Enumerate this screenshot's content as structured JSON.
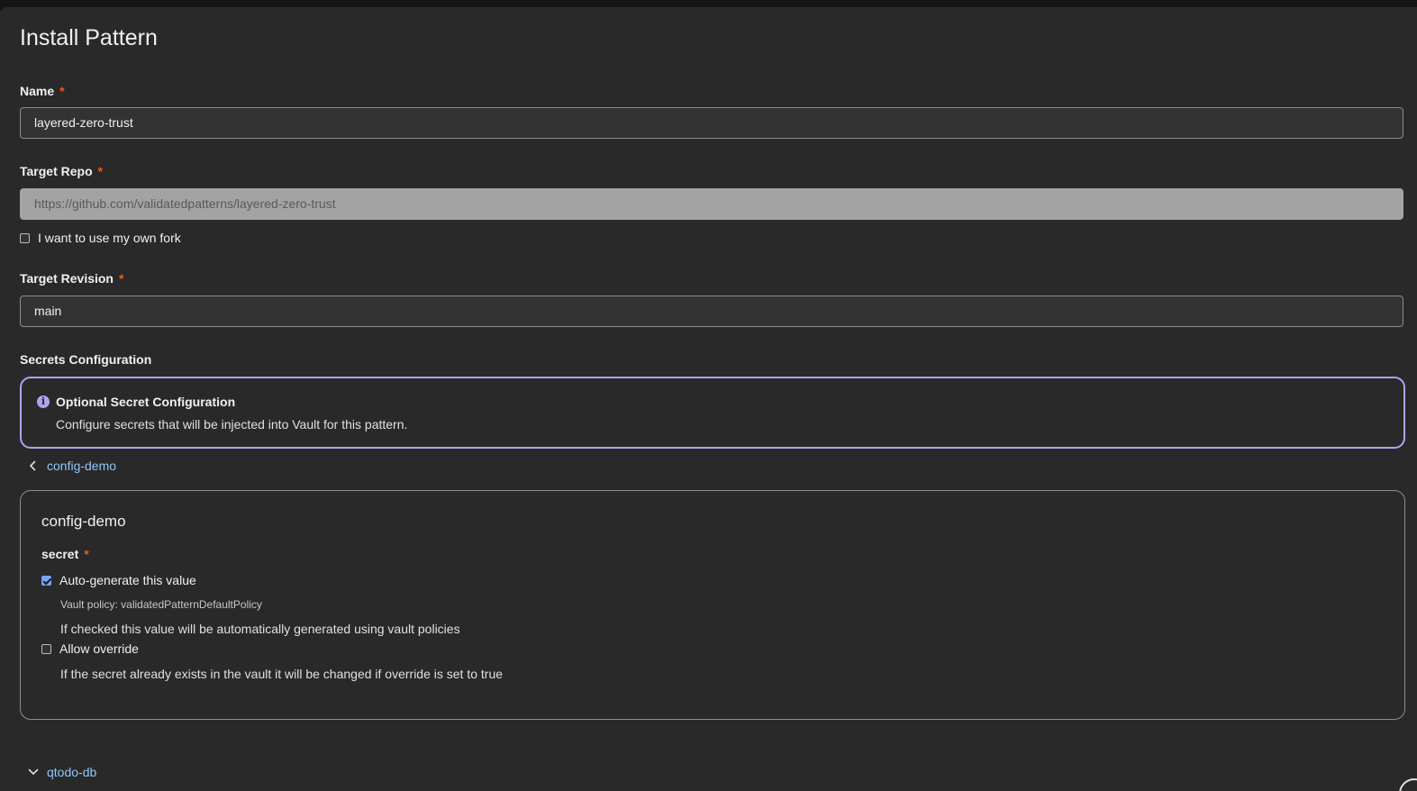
{
  "page": {
    "title": "Install Pattern"
  },
  "name_field": {
    "label": "Name",
    "required_marker": "*",
    "value": "layered-zero-trust"
  },
  "target_repo": {
    "label": "Target Repo",
    "required_marker": "*",
    "value": "https://github.com/validatedpatterns/layered-zero-trust",
    "fork_checkbox_label": "I want to use my own fork",
    "fork_checked": false
  },
  "target_revision": {
    "label": "Target Revision",
    "required_marker": "*",
    "value": "main"
  },
  "secrets": {
    "section_label": "Secrets Configuration",
    "alert": {
      "icon": "info-icon",
      "title": "Optional Secret Configuration",
      "body": "Configure secrets that will be injected into Vault for this pattern."
    },
    "groups": [
      {
        "name": "config-demo",
        "expanded": true,
        "panel_title": "config-demo",
        "field_label": "secret",
        "required_marker": "*",
        "auto_generate_label": "Auto-generate this value",
        "auto_generate_checked": true,
        "vault_policy": "Vault policy: validatedPatternDefaultPolicy",
        "auto_generate_help": "If checked this value will be automatically generated using vault policies",
        "override_label": "Allow override",
        "override_checked": false,
        "override_help": "If the secret already exists in the vault it will be changed if override is set to true"
      },
      {
        "name": "qtodo-db",
        "expanded": false
      }
    ]
  },
  "colors": {
    "background": "#292929",
    "required": "#f0561d",
    "link": "#92c5f9",
    "info_accent": "#b2a3f0",
    "checkbox_checked": "#73a5f5"
  }
}
